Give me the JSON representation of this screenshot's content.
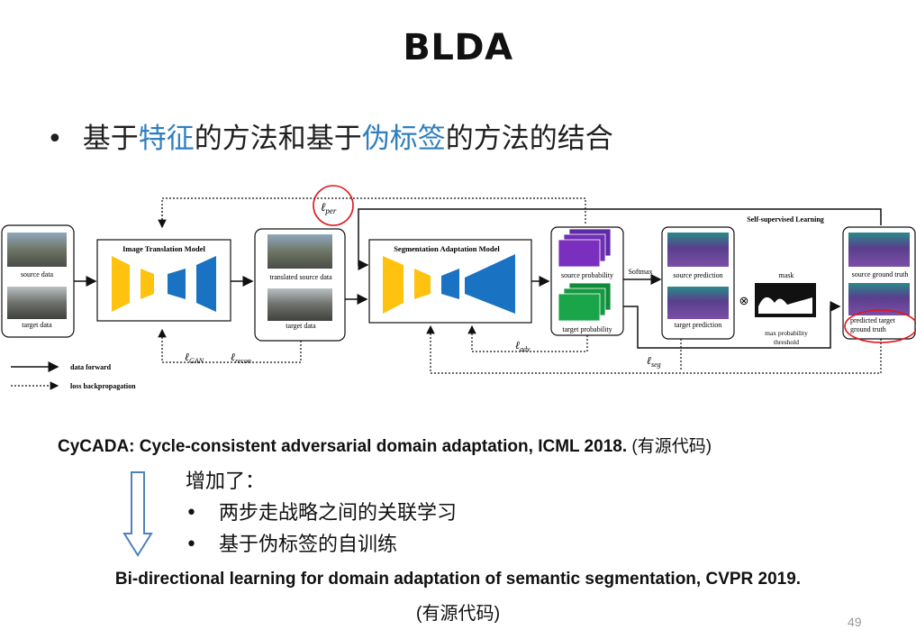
{
  "slide": {
    "title": "BLDA",
    "bullet": {
      "parts": [
        "基于",
        "特征",
        "的方法和基于",
        "伪标签",
        "的方法的结合"
      ],
      "highlight_color": "#2f7fbf"
    },
    "diagram": {
      "nodes": {
        "source_data": "source data",
        "target_data": "target data",
        "image_translation_model": "Image Translation Model",
        "translated_source_data": "translated source data",
        "target_data_2": "target data",
        "segmentation_adaptation_model": "Segmentation Adaptation Model",
        "source_probability": "source probability",
        "target_probability": "target probability",
        "softmax": "Softmax",
        "source_prediction": "source prediction",
        "target_prediction": "target prediction",
        "mask": "mask",
        "max_probability_threshold_1": "max probability",
        "max_probability_threshold_2": "threshold",
        "self_supervised_learning": "Self-supervised Learning",
        "source_ground_truth": "source ground truth",
        "predicted_target_gt_1": "predicted target",
        "predicted_target_gt_2": "ground truth",
        "otimes": "⊗"
      },
      "losses": {
        "l_per": {
          "symbol": "ℓ",
          "sub": "per"
        },
        "l_gan": {
          "symbol": "ℓ",
          "sub": "GAN"
        },
        "l_recon": {
          "symbol": "ℓ",
          "sub": "recon"
        },
        "l_adv": {
          "symbol": "ℓ",
          "sub": "adv"
        },
        "l_seg": {
          "symbol": "ℓ",
          "sub": "seg"
        }
      },
      "legend": {
        "data_forward": "data forward",
        "loss_backpropagation": "loss backpropagation"
      },
      "colors": {
        "encoder": "#ffc20e",
        "decoder": "#1a72c2",
        "prob_purple": "#7b2fbe",
        "prob_green": "#1aa54a",
        "annotation_red": "#e0161b"
      }
    },
    "paper1": {
      "text": "CyCADA: Cycle-consistent adversarial domain adaptation, ICML 2018.",
      "source": "(有源代码)"
    },
    "added": {
      "heading": "增加了：",
      "items": [
        "两步走战略之间的关联学习",
        "基于伪标签的自训练"
      ]
    },
    "paper2": {
      "text": "Bi-directional learning for domain adaptation of semantic segmentation, CVPR 2019.",
      "source": "(有源代码)"
    },
    "page_number": "49"
  }
}
